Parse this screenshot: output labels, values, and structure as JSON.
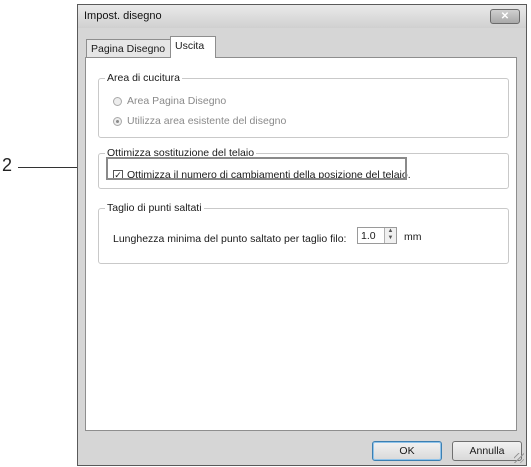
{
  "callout": {
    "number": "2"
  },
  "window": {
    "title": "Impost. disegno",
    "close_symbol": "✕"
  },
  "tabs": [
    {
      "label": "Pagina Disegno",
      "active": false
    },
    {
      "label": "Uscita",
      "active": true
    }
  ],
  "sewing_area": {
    "legend": "Area di cucitura",
    "options": [
      {
        "label": "Area Pagina Disegno",
        "selected": false,
        "enabled": false
      },
      {
        "label": "Utilizza area esistente del disegno",
        "selected": true,
        "enabled": false
      }
    ]
  },
  "frame_optimization": {
    "legend": "Ottimizza sostituzione del telaio",
    "checkbox_label": "Ottimizza il numero di cambiamenti della posizione del telaio.",
    "checked": true,
    "check_mark": "✓"
  },
  "jump_trim": {
    "legend": "Taglio di punti saltati",
    "field_label": "Lunghezza minima del punto saltato per taglio filo:",
    "value": "1.0",
    "unit": "mm"
  },
  "buttons": {
    "ok": "OK",
    "cancel": "Annulla"
  }
}
